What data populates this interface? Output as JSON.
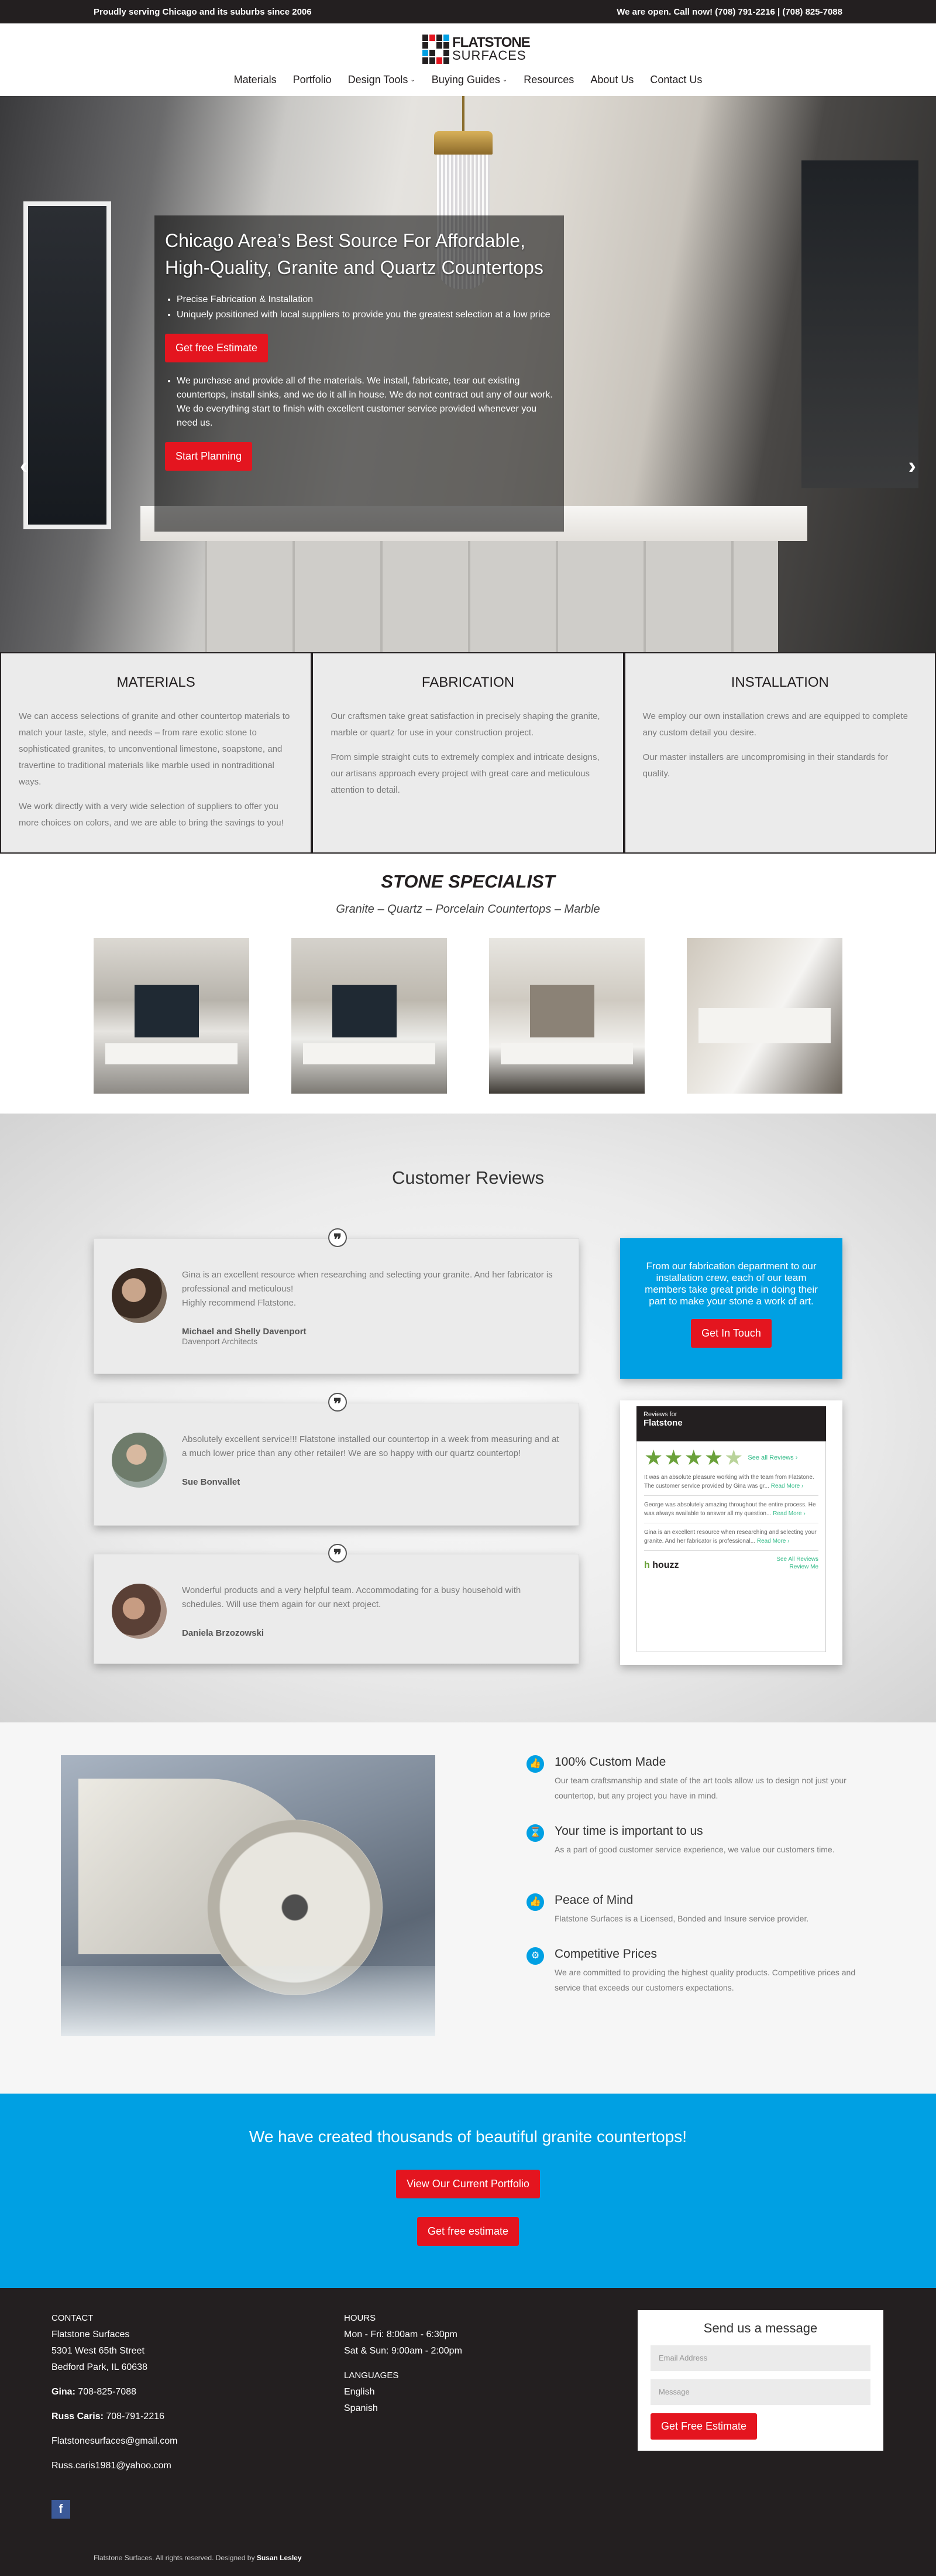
{
  "topbar": {
    "left": "Proudly serving Chicago and its suburbs since 2006",
    "right": "We are open. Call now! (708) 791-2216  |  (708) 825-7088"
  },
  "logo": {
    "line1": "FLATSTONE",
    "line2": "SURFACES"
  },
  "nav": {
    "items": [
      "Materials",
      "Portfolio",
      "Design Tools",
      "Buying Guides",
      "Resources",
      "About Us",
      "Contact Us"
    ]
  },
  "hero": {
    "title": "Chicago Area’s Best Source For Affordable, High-Quality, Granite and Quartz Countertops",
    "bullets1": [
      "Precise Fabrication & Installation",
      "Uniquely positioned with local suppliers to provide you the greatest selection at a low price"
    ],
    "button1": "Get free Estimate",
    "bullets2": [
      "We purchase and provide all of the materials. We install, fabricate, tear out existing countertops, install sinks, and we do it all in house. We do not contract out any of our work. We do everything start to finish with excellent customer service provided whenever you need us."
    ],
    "button2": "Start Planning",
    "slide_count": 7,
    "active_slide": 0
  },
  "services": [
    {
      "title": "MATERIALS",
      "paras": [
        "We can access selections of granite and other countertop materials to match your taste, style, and needs – from rare exotic stone to sophisticated granites, to unconventional limestone, soapstone, and travertine to traditional materials like marble used in nontraditional ways.",
        "We work directly with a very wide selection of suppliers to offer you more choices on colors, and we are able to bring the savings to you!"
      ]
    },
    {
      "title": "FABRICATION",
      "paras": [
        "Our craftsmen take great satisfaction in precisely shaping the granite, marble or quartz for use in your construction project.",
        "From simple straight cuts to extremely complex and intricate designs, our artisans approach every project with great care and meticulous attention to detail."
      ]
    },
    {
      "title": "INSTALLATION",
      "paras": [
        "We employ our own installation crews and are equipped to complete any custom detail you desire.",
        "Our master installers are uncompromising in their standards for quality."
      ]
    }
  ],
  "specialist": {
    "title": "STONE SPECIALIST",
    "subtitle": "Granite – Quartz – Porcelain Countertops – Marble"
  },
  "reviews": {
    "heading": "Customer Reviews",
    "items": [
      {
        "text": "Gina is an excellent resource when researching and selecting your granite. And her fabricator is professional and meticulous!\nHighly recommend Flatstone.",
        "name": "Michael and Shelly Davenport",
        "org": "Davenport Architects"
      },
      {
        "text": "Absolutely excellent service!!! Flatstone installed our countertop in a week from measuring and at a much lower price than any other retailer! We are so happy with our quartz countertop!",
        "name": "Sue Bonvallet",
        "org": ""
      },
      {
        "text": "Wonderful products and a very helpful team. Accommodating for a busy household with schedules. Will use them again for our next project.",
        "name": "Daniela Brzozowski",
        "org": ""
      }
    ],
    "blue_text": "From our fabrication department to our installation crew, each of our team members take great pride in doing their part to make your stone a work of art.",
    "blue_button": "Get In Touch",
    "houzz": {
      "sub": "Reviews for",
      "name": "Flatstone",
      "see_all": "See all Reviews ›",
      "rating": 4.5,
      "reviews": [
        "It was an absolute pleasure working with the team from Flatstone. The customer service provided by Gina was gr...",
        "George was absolutely amazing throughout the entire process. He was always available to answer all my question...",
        "Gina is an excellent resource when researching and selecting your granite. And her fabricator is professional..."
      ],
      "read_more": "Read More ›",
      "brand": "houzz",
      "links": [
        "See All Reviews",
        "Review Me"
      ]
    }
  },
  "features": [
    {
      "icon": "thumbs-up-icon",
      "glyph": "👍",
      "title": "100% Custom Made",
      "text": "Our team craftsmanship and state of the art tools allow us to design not just your countertop, but any project you have in mind."
    },
    {
      "icon": "hourglass-icon",
      "glyph": "⌛",
      "title": "Your time is important to us",
      "text": "As a part of good customer service experience, we value our customers time."
    },
    {
      "icon": "thumbs-up-icon",
      "glyph": "👍",
      "title": "Peace of Mind",
      "text": "Flatstone Surfaces is a Licensed, Bonded and Insure service provider."
    },
    {
      "icon": "gear-icon",
      "glyph": "⚙",
      "title": "Competitive Prices",
      "text": "We are committed to providing the highest quality products. Competitive prices and service that exceeds our customers expectations."
    }
  ],
  "cta": {
    "title": "We have created thousands of beautiful granite countertops!",
    "button1": "View Our Current Portfolio",
    "button2": "Get free estimate"
  },
  "footer": {
    "contact_heading": "CONTACT",
    "company": "Flatstone Surfaces",
    "street": "5301 West 65th Street",
    "city": "Bedford Park, IL 60638",
    "gina_label": "Gina:",
    "gina_phone": "708-825-7088",
    "russ_label": "Russ Caris:",
    "russ_phone": "708-791-2216",
    "email1": "Flatstonesurfaces@gmail.com",
    "email2": "Russ.caris1981@yahoo.com",
    "hours_heading": "HOURS",
    "hours": [
      "Mon - Fri: 8:00am - 6:30pm",
      "Sat & Sun: 9:00am - 2:00pm"
    ],
    "lang_heading": "LANGUAGES",
    "languages": [
      "English",
      "Spanish"
    ],
    "form_title": "Send us a message",
    "email_placeholder": "Email Address",
    "message_placeholder": "Message",
    "form_button": "Get Free Estimate",
    "copyright": "Flatstone Surfaces. All rights reserved. Designed by",
    "designer": "Susan Lesley"
  },
  "colors": {
    "accent_red": "#e4151f",
    "accent_blue": "#00a0e3",
    "dark": "#231f20",
    "star_green": "#6aa13a"
  }
}
